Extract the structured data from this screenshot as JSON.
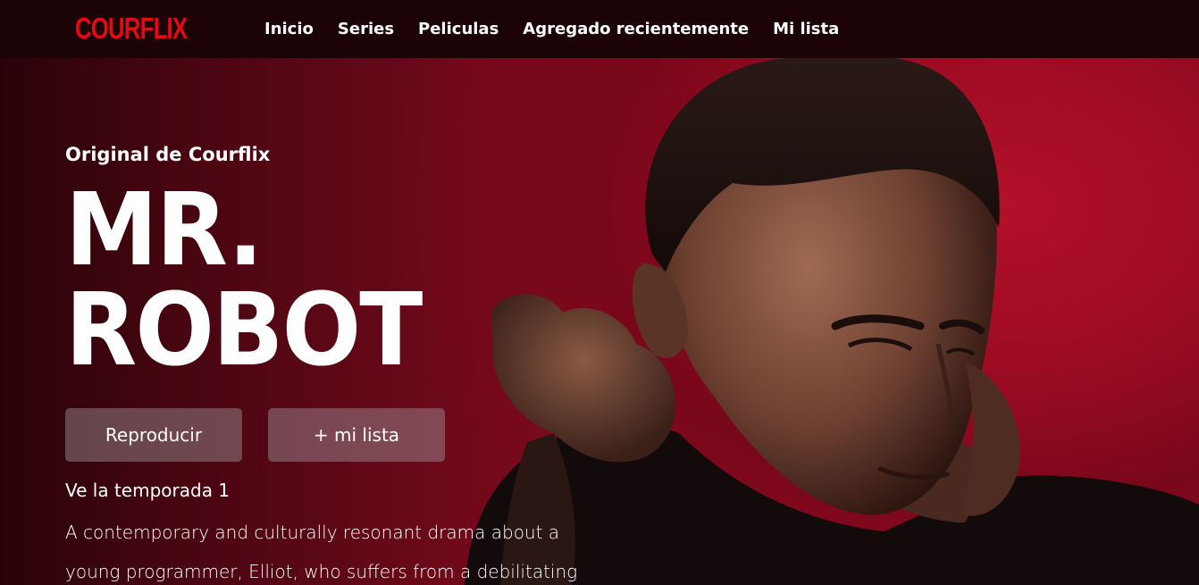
{
  "brand": {
    "logo": "COURFLIX",
    "logo_color": "#e50914"
  },
  "nav": {
    "items": [
      {
        "label": "Inicio"
      },
      {
        "label": "Series"
      },
      {
        "label": "Peliculas"
      },
      {
        "label": "Agregado recientemente"
      },
      {
        "label": "Mi lista"
      }
    ]
  },
  "hero": {
    "eyebrow": "Original de Courflix",
    "title_line1": "MR.",
    "title_line2": "ROBOT",
    "play_label": "Reproducir",
    "mylist_label": "+ mi lista",
    "season_label": "Ve la temporada 1",
    "synopsis": "A contemporary and culturally resonant drama about a young programmer, Elliot, who suffers from a debilitating"
  },
  "colors": {
    "background_red": "#a30e26",
    "header_bg": "#1c0406"
  }
}
